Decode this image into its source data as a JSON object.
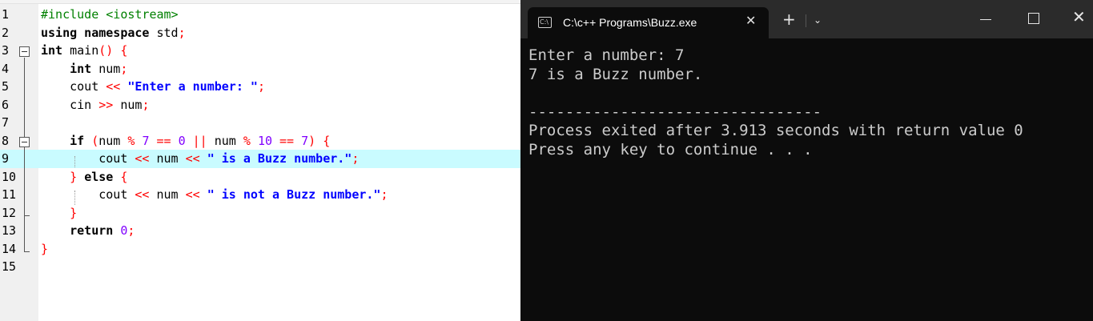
{
  "editor": {
    "line_numbers": [
      "1",
      "2",
      "3",
      "4",
      "5",
      "6",
      "7",
      "8",
      "9",
      "10",
      "11",
      "12",
      "13",
      "14",
      "15"
    ],
    "lines": [
      [
        {
          "t": "#include <iostream>",
          "c": "pp"
        }
      ],
      [
        {
          "t": "using namespace ",
          "c": "kw"
        },
        {
          "t": "std"
        },
        {
          "t": ";",
          "c": "op"
        }
      ],
      [
        {
          "t": "int ",
          "c": "kw"
        },
        {
          "t": "main"
        },
        {
          "t": "() {",
          "c": "op"
        }
      ],
      [
        {
          "t": "    "
        },
        {
          "t": "int ",
          "c": "kw"
        },
        {
          "t": "num"
        },
        {
          "t": ";",
          "c": "op"
        }
      ],
      [
        {
          "t": "    cout "
        },
        {
          "t": "<< ",
          "c": "op"
        },
        {
          "t": "\"Enter a number: \"",
          "c": "str"
        },
        {
          "t": ";",
          "c": "op"
        }
      ],
      [
        {
          "t": "    cin "
        },
        {
          "t": ">> ",
          "c": "op"
        },
        {
          "t": "num"
        },
        {
          "t": ";",
          "c": "op"
        }
      ],
      [],
      [
        {
          "t": "    "
        },
        {
          "t": "if ",
          "c": "kw"
        },
        {
          "t": "(",
          "c": "op"
        },
        {
          "t": "num "
        },
        {
          "t": "% ",
          "c": "op"
        },
        {
          "t": "7 ",
          "c": "num"
        },
        {
          "t": "== ",
          "c": "op"
        },
        {
          "t": "0 ",
          "c": "num"
        },
        {
          "t": "|| ",
          "c": "op"
        },
        {
          "t": "num "
        },
        {
          "t": "% ",
          "c": "op"
        },
        {
          "t": "10 ",
          "c": "num"
        },
        {
          "t": "== ",
          "c": "op"
        },
        {
          "t": "7",
          "c": "num"
        },
        {
          "t": ") {",
          "c": "op"
        }
      ],
      [
        {
          "t": "        cout "
        },
        {
          "t": "<< ",
          "c": "op"
        },
        {
          "t": "num "
        },
        {
          "t": "<< ",
          "c": "op"
        },
        {
          "t": "\" is a Buzz number.\"",
          "c": "str"
        },
        {
          "t": ";",
          "c": "op"
        }
      ],
      [
        {
          "t": "    "
        },
        {
          "t": "} ",
          "c": "op"
        },
        {
          "t": "else ",
          "c": "kw"
        },
        {
          "t": "{",
          "c": "op"
        }
      ],
      [
        {
          "t": "        cout "
        },
        {
          "t": "<< ",
          "c": "op"
        },
        {
          "t": "num "
        },
        {
          "t": "<< ",
          "c": "op"
        },
        {
          "t": "\" is not a Buzz number.\"",
          "c": "str"
        },
        {
          "t": ";",
          "c": "op"
        }
      ],
      [
        {
          "t": "    "
        },
        {
          "t": "}",
          "c": "op"
        }
      ],
      [
        {
          "t": "    "
        },
        {
          "t": "return ",
          "c": "kw"
        },
        {
          "t": "0",
          "c": "num"
        },
        {
          "t": ";",
          "c": "op"
        }
      ],
      [
        {
          "t": "}",
          "c": "op"
        }
      ],
      []
    ],
    "highlighted_line": 9
  },
  "console": {
    "tab_title": "C:\\c++ Programs\\Buzz.exe",
    "tab_icon_text": "C:\\",
    "close_glyph": "✕",
    "new_tab_glyph": "+",
    "dropdown_glyph": "⌄",
    "window_close_glyph": "✕",
    "output_lines": [
      "Enter a number: 7",
      "7 is a Buzz number.",
      "",
      "--------------------------------",
      "Process exited after 3.913 seconds with return value 0",
      "Press any key to continue . . ."
    ]
  },
  "colors": {
    "keyword": "#000000",
    "preprocessor": "#008000",
    "string": "#0000ff",
    "operator": "#ff0000",
    "number": "#8000ff",
    "highlight": "#c9fbff",
    "console_bg": "#0c0c0c",
    "console_text": "#cccccc"
  }
}
